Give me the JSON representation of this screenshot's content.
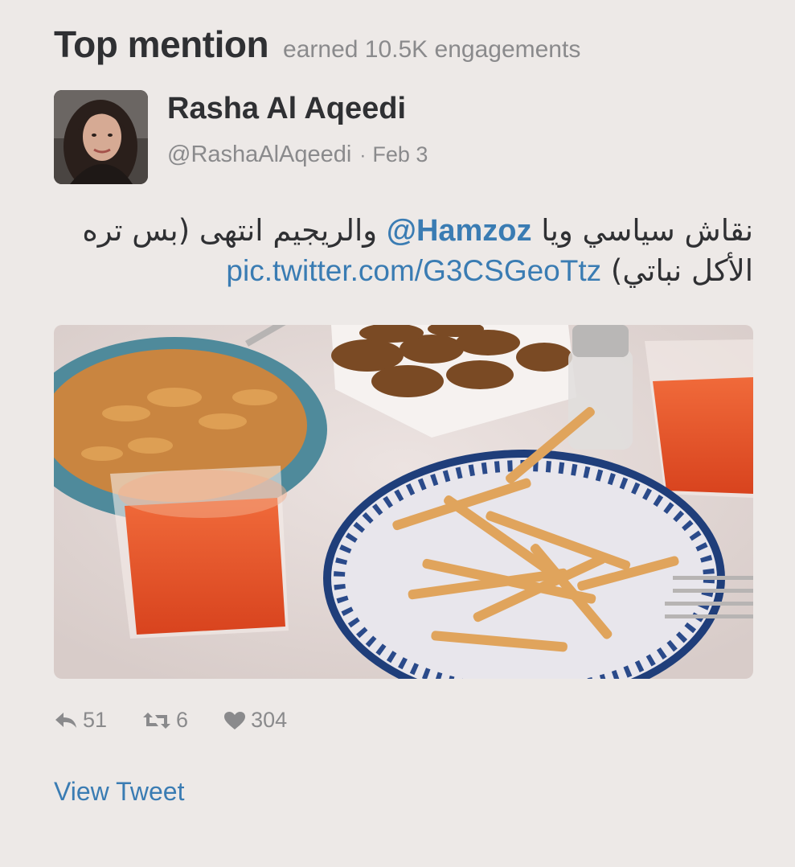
{
  "header": {
    "title": "Top mention",
    "subtitle": "earned 10.5K engagements"
  },
  "author": {
    "name": "Rasha Al Aqeedi",
    "handle": "@RashaAlAqeedi",
    "separator": "·",
    "date": "Feb 3"
  },
  "tweet": {
    "text_before_mention": "نقاش سياسي ويا ",
    "mention": "@Hamzoz",
    "text_after_mention": " والريجيم انتهى (بس تره الأكل نباتي) ",
    "link": "pic.twitter.com/G3CSGeoTtz"
  },
  "media": {
    "icon": "photo-food-table"
  },
  "actions": {
    "replies": "51",
    "retweets": "6",
    "likes": "304"
  },
  "footer": {
    "view_tweet_label": "View Tweet"
  },
  "colors": {
    "background": "#ede9e7",
    "link": "#3a7cb3",
    "muted": "#8a8a8c",
    "text": "#2f3033"
  }
}
